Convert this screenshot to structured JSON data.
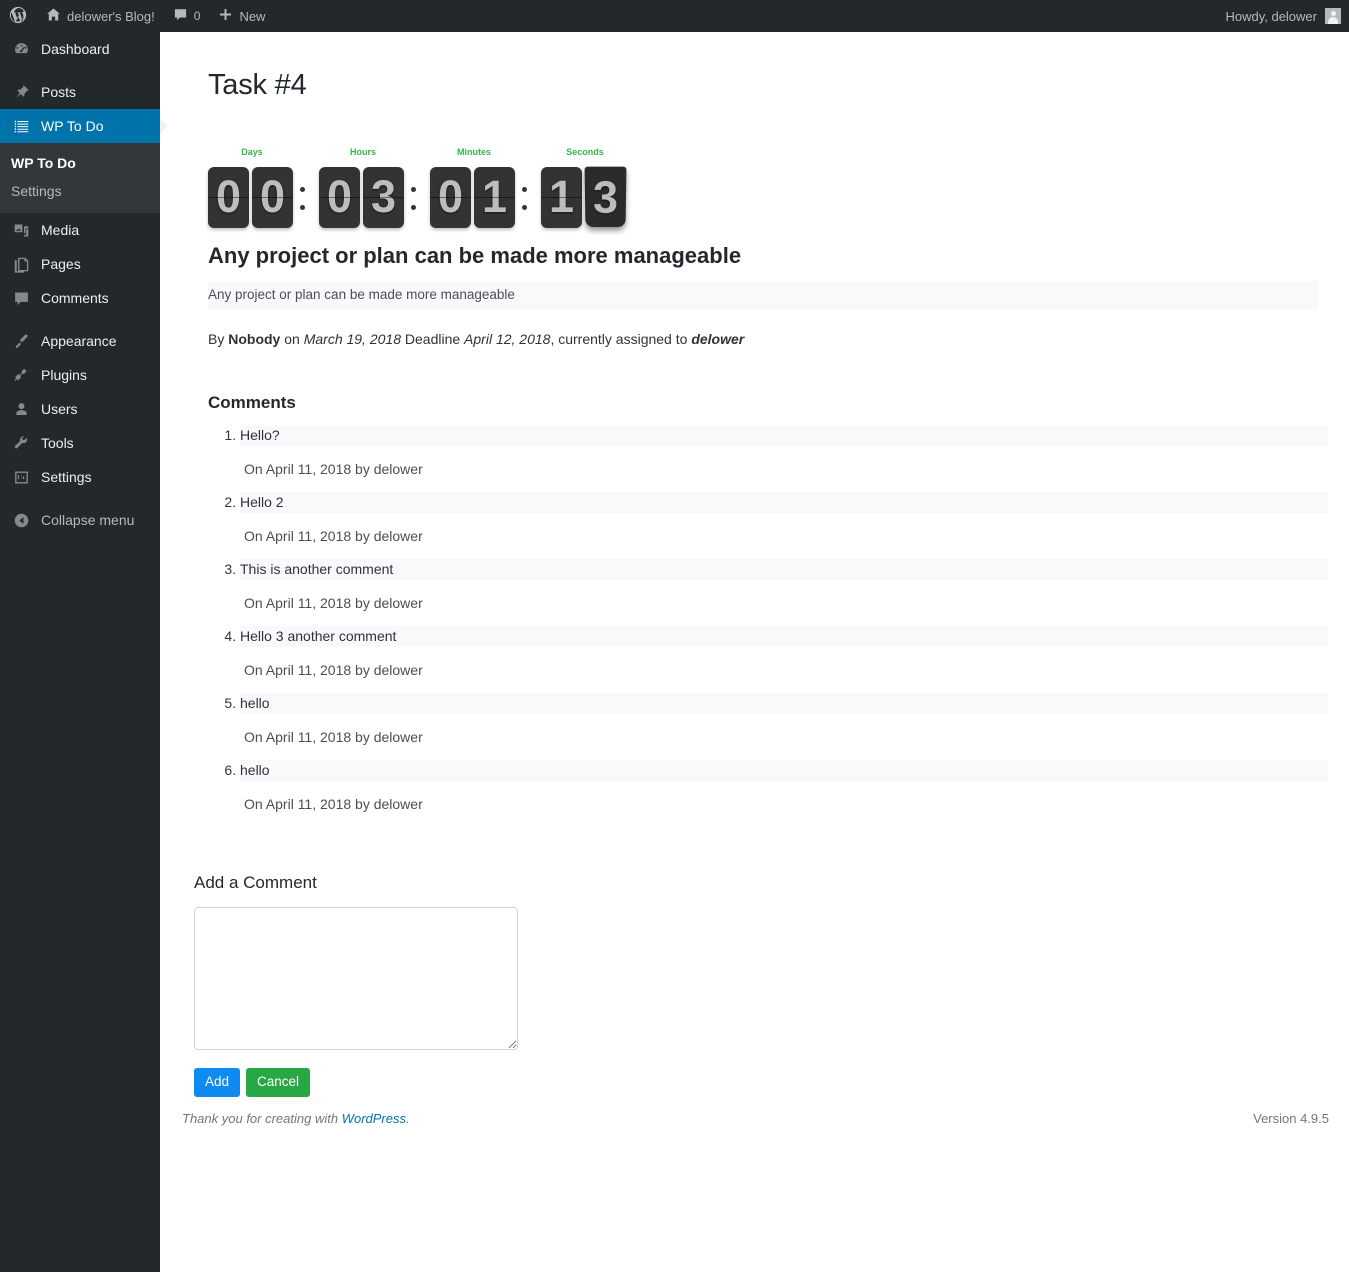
{
  "adminbar": {
    "wp_logo_icon": "wordpress-logo-icon",
    "site_icon": "home-icon",
    "site_name": "delower's Blog!",
    "comments_icon": "comment-bubble-icon",
    "comments_count": "0",
    "new_icon": "plus-icon",
    "new_label": "New",
    "howdy": "Howdy, delower",
    "avatar_icon": "avatar-icon"
  },
  "sidebar": {
    "items": [
      {
        "label": "Dashboard",
        "icon": "dashboard-icon",
        "current": false
      },
      {
        "label": "Posts",
        "icon": "pin-icon",
        "current": false
      },
      {
        "label": "WP To Do",
        "icon": "list-icon",
        "current": true
      },
      {
        "label": "Media",
        "icon": "media-icon",
        "current": false
      },
      {
        "label": "Pages",
        "icon": "pages-icon",
        "current": false
      },
      {
        "label": "Comments",
        "icon": "comment-bubble-icon",
        "current": false
      },
      {
        "label": "Appearance",
        "icon": "paintbrush-icon",
        "current": false
      },
      {
        "label": "Plugins",
        "icon": "plug-icon",
        "current": false
      },
      {
        "label": "Users",
        "icon": "user-icon",
        "current": false
      },
      {
        "label": "Tools",
        "icon": "wrench-icon",
        "current": false
      },
      {
        "label": "Settings",
        "icon": "settings-sliders-icon",
        "current": false
      }
    ],
    "submenu": [
      {
        "label": "WP To Do",
        "current": true
      },
      {
        "label": "Settings",
        "current": false
      }
    ],
    "collapse": {
      "label": "Collapse menu",
      "icon": "collapse-arrow-icon"
    }
  },
  "main": {
    "page_title": "Task #4",
    "countdown": {
      "days_label": "Days",
      "hours_label": "Hours",
      "minutes_label": "Minutes",
      "seconds_label": "Seconds",
      "days": [
        "0",
        "0"
      ],
      "hours": [
        "0",
        "3"
      ],
      "minutes": [
        "0",
        "1"
      ],
      "seconds": [
        "1",
        "3"
      ],
      "separator": ":",
      "label_color": "#39b54a",
      "digit_bg": "#333333",
      "digit_color": "#bdbdbd"
    },
    "task": {
      "title": "Any project or plan can be made more manageable",
      "description": "Any project or plan can be made more manageable",
      "meta_by_prefix": "By",
      "meta_author": "Nobody",
      "meta_on": "on",
      "meta_created": "March 19, 2018",
      "meta_deadline_label": "Deadline",
      "meta_deadline": "April 12, 2018",
      "meta_assigned_text": ", currently assigned to",
      "meta_assignee": "delower"
    },
    "comments_heading": "Comments",
    "comments": [
      {
        "text": "Hello?",
        "meta": "On April 11, 2018 by delower"
      },
      {
        "text": "Hello 2",
        "meta": "On April 11, 2018 by delower"
      },
      {
        "text": "This is another comment",
        "meta": "On April 11, 2018 by delower"
      },
      {
        "text": "Hello 3 another comment",
        "meta": "On April 11, 2018 by delower"
      },
      {
        "text": "hello",
        "meta": "On April 11, 2018 by delower"
      },
      {
        "text": "hello",
        "meta": "On April 11, 2018 by delower"
      }
    ],
    "add_comment": {
      "heading": "Add a Comment",
      "textarea_value": "",
      "textarea_placeholder": "",
      "add_label": "Add",
      "cancel_label": "Cancel",
      "add_color": "#0d8bf2",
      "cancel_color": "#28a745"
    }
  },
  "footer": {
    "thanks_prefix": "Thank you for creating with",
    "wordpress_link": "WordPress",
    "thanks_suffix": ".",
    "version": "Version 4.9.5"
  }
}
